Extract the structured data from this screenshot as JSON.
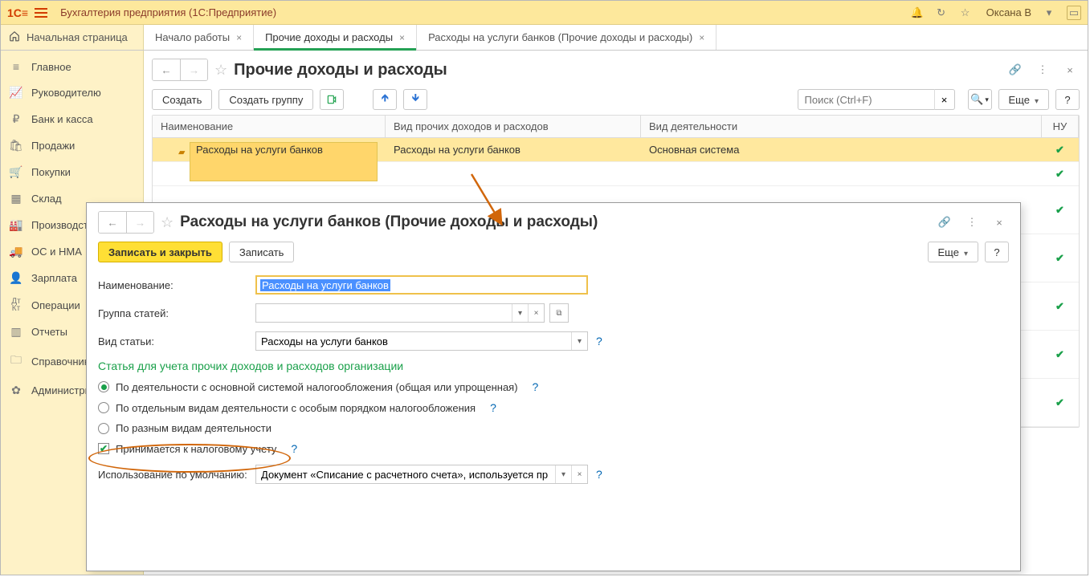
{
  "titlebar": {
    "logo": "1С",
    "title": "Бухгалтерия предприятия  (1С:Предприятие)",
    "user": "Оксана В"
  },
  "tabs": {
    "home": "Начальная страница",
    "t1": "Начало работы",
    "t2": "Прочие доходы и расходы",
    "t3": "Расходы на услуги банков (Прочие доходы и расходы)"
  },
  "sidebar": {
    "items": [
      {
        "label": "Главное"
      },
      {
        "label": "Руководителю"
      },
      {
        "label": "Банк и касса"
      },
      {
        "label": "Продажи"
      },
      {
        "label": "Покупки"
      },
      {
        "label": "Склад"
      },
      {
        "label": "Производство"
      },
      {
        "label": "ОС и НМА"
      },
      {
        "label": "Зарплата"
      },
      {
        "label": "Операции"
      },
      {
        "label": "Отчеты"
      },
      {
        "label": "Справочники"
      },
      {
        "label": "Администрирование"
      }
    ]
  },
  "list": {
    "title": "Прочие доходы и расходы",
    "create": "Создать",
    "create_group": "Создать группу",
    "search_placeholder": "Поиск (Ctrl+F)",
    "more": "Еще",
    "cols": {
      "name": "Наименование",
      "kind": "Вид прочих доходов и расходов",
      "act": "Вид деятельности",
      "nu": "НУ"
    },
    "row": {
      "name": "Расходы на услуги банков",
      "kind": "Расходы на услуги банков",
      "act": "Основная система"
    }
  },
  "modal": {
    "title": "Расходы на услуги банков (Прочие доходы и расходы)",
    "save_close": "Записать и закрыть",
    "save": "Записать",
    "more": "Еще",
    "name_label": "Наименование:",
    "name_value": "Расходы на услуги банков",
    "group_label": "Группа статей:",
    "kind_label": "Вид статьи:",
    "kind_value": "Расходы на услуги банков",
    "section": "Статья для учета прочих доходов и расходов организации",
    "r1": "По деятельности с основной системой налогообложения (общая или упрощенная)",
    "r2": "По отдельным видам деятельности с особым порядком налогообложения",
    "r3": "По разным видам деятельности",
    "tax_check": "Принимается к налоговому учету",
    "default_label": "Использование по умолчанию:",
    "default_value": "Документ «Списание с расчетного счета», используется пр"
  },
  "glyphs": {
    "q": "?",
    "star": "☆",
    "link": "🔗",
    "dots": "⋮",
    "x": "×",
    "left": "←",
    "right": "→",
    "up": "🡹",
    "down": "🡻",
    "search": "🔍",
    "bell": "🔔",
    "clock": "↻",
    "fav": "☆",
    "dd": "▾",
    "check": "✔",
    "ext": "⧉"
  }
}
